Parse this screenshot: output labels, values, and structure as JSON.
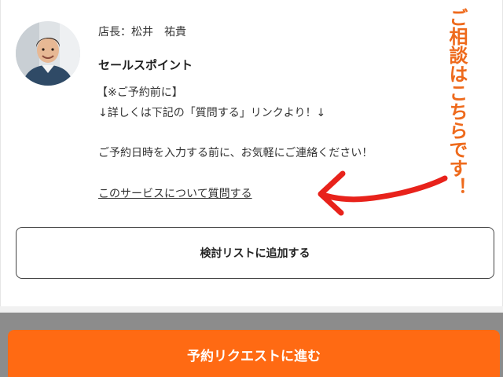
{
  "profile": {
    "owner_label": "店長：松井　祐貴",
    "avatar_icon": "staff-photo"
  },
  "sales_point": {
    "title": "セールスポイント",
    "line1": "【※ご予約前に】",
    "line2": "↓詳しくは下記の「質問する」リンクより！↓",
    "line3": "ご予約日時を入力する前に、お気軽にご連絡ください！",
    "question_link": "このサービスについて質問する"
  },
  "annotation": {
    "text": "ご相談はこちらです！",
    "color": "#ee6a1c",
    "arrow_icon": "arrow-left-icon"
  },
  "actions": {
    "wishlist_label": "検討リストに追加する",
    "reserve_label": "予約リクエストに進む",
    "reserve_color": "#ff6a13"
  }
}
